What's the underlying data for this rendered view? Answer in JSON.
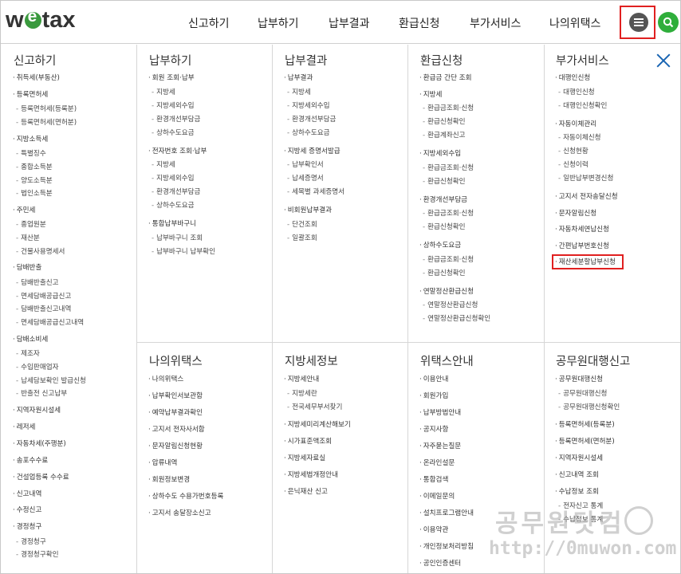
{
  "brand": {
    "logo_pre": "w",
    "logo_post": "tax"
  },
  "gnb": [
    "신고하기",
    "납부하기",
    "납부결과",
    "환급신청",
    "부가서비스",
    "나의위택스"
  ],
  "icons": {
    "menu": "hamburger-menu-icon",
    "search": "search-icon",
    "close": "close-icon"
  },
  "colors": {
    "highlight": "#e02020",
    "accent_green": "#2fae3b",
    "close_blue": "#1a66b3"
  },
  "sections": [
    {
      "title": "신고하기",
      "items": [
        {
          "t": "취득세(부동산)",
          "l": 1
        },
        {
          "t": "등록면허세",
          "l": 1
        },
        {
          "t": "등록면허세(등록분)",
          "l": 2
        },
        {
          "t": "등록면허세(면허분)",
          "l": 2
        },
        {
          "t": "지방소득세",
          "l": 1
        },
        {
          "t": "특별징수",
          "l": 2
        },
        {
          "t": "종합소득분",
          "l": 2
        },
        {
          "t": "양도소득분",
          "l": 2
        },
        {
          "t": "법인소득분",
          "l": 2
        },
        {
          "t": "주민세",
          "l": 1
        },
        {
          "t": "종업원분",
          "l": 2
        },
        {
          "t": "재산분",
          "l": 2
        },
        {
          "t": "건물사용명세서",
          "l": 2
        },
        {
          "t": "담배반출",
          "l": 1
        },
        {
          "t": "담배반출신고",
          "l": 2
        },
        {
          "t": "면세담배공급신고",
          "l": 2
        },
        {
          "t": "담배반출신고내역",
          "l": 2
        },
        {
          "t": "면세담배공급신고내역",
          "l": 2
        },
        {
          "t": "담배소비세",
          "l": 1
        },
        {
          "t": "제조자",
          "l": 2
        },
        {
          "t": "수입판매업자",
          "l": 2
        },
        {
          "t": "납세담보확인 발급신청",
          "l": 2
        },
        {
          "t": "반출전 신고납부",
          "l": 2
        },
        {
          "t": "지역자원시설세",
          "l": 1
        },
        {
          "t": "레저세",
          "l": 1
        },
        {
          "t": "자동차세(주행분)",
          "l": 1
        },
        {
          "t": "송포수수료",
          "l": 1
        },
        {
          "t": "건설업등록 수수료",
          "l": 1
        },
        {
          "t": "신고내역",
          "l": 1
        },
        {
          "t": "수정신고",
          "l": 1
        },
        {
          "t": "경정청구",
          "l": 1
        },
        {
          "t": "경정청구",
          "l": 2
        },
        {
          "t": "경정청구확인",
          "l": 2
        }
      ]
    },
    {
      "title": "납부하기",
      "items": [
        {
          "t": "회원 조회·납부",
          "l": 1
        },
        {
          "t": "지방세",
          "l": 2
        },
        {
          "t": "지방세외수입",
          "l": 2
        },
        {
          "t": "환경개선부담금",
          "l": 2
        },
        {
          "t": "상하수도요금",
          "l": 2
        },
        {
          "t": "전자번호 조회·납부",
          "l": 1
        },
        {
          "t": "지방세",
          "l": 2
        },
        {
          "t": "지방세외수입",
          "l": 2
        },
        {
          "t": "환경개선부담금",
          "l": 2
        },
        {
          "t": "상하수도요금",
          "l": 2
        },
        {
          "t": "통합납부바구니",
          "l": 1
        },
        {
          "t": "납부바구니 조회",
          "l": 2
        },
        {
          "t": "납부바구니 납부확인",
          "l": 2
        }
      ]
    },
    {
      "title": "납부결과",
      "items": [
        {
          "t": "납부결과",
          "l": 1
        },
        {
          "t": "지방세",
          "l": 2
        },
        {
          "t": "지방세외수입",
          "l": 2
        },
        {
          "t": "환경개선부담금",
          "l": 2
        },
        {
          "t": "상하수도요금",
          "l": 2
        },
        {
          "t": "지방세 증명서발급",
          "l": 1
        },
        {
          "t": "납부확인서",
          "l": 2
        },
        {
          "t": "납세증명서",
          "l": 2
        },
        {
          "t": "세목별 과세증명서",
          "l": 2
        },
        {
          "t": "비회원납부결과",
          "l": 1
        },
        {
          "t": "단건조회",
          "l": 2
        },
        {
          "t": "일괄조회",
          "l": 2
        }
      ]
    },
    {
      "title": "환급신청",
      "items": [
        {
          "t": "환급금 간단 조회",
          "l": 1
        },
        {
          "t": "지방세",
          "l": 1
        },
        {
          "t": "환급금조회·신청",
          "l": 2
        },
        {
          "t": "환급신청확인",
          "l": 2
        },
        {
          "t": "환급계좌신고",
          "l": 2
        },
        {
          "t": "지방세외수입",
          "l": 1
        },
        {
          "t": "환급금조회·신청",
          "l": 2
        },
        {
          "t": "환급신청확인",
          "l": 2
        },
        {
          "t": "환경개선부담금",
          "l": 1
        },
        {
          "t": "환급금조회·신청",
          "l": 2
        },
        {
          "t": "환급신청확인",
          "l": 2
        },
        {
          "t": "상하수도요금",
          "l": 1
        },
        {
          "t": "환급금조회·신청",
          "l": 2
        },
        {
          "t": "환급신청확인",
          "l": 2
        },
        {
          "t": "연말정산환급신청",
          "l": 1
        },
        {
          "t": "연말정산환급신청",
          "l": 2
        },
        {
          "t": "연말정산환급신청확인",
          "l": 2
        }
      ]
    },
    {
      "title": "부가서비스",
      "items": [
        {
          "t": "대행인신청",
          "l": 1
        },
        {
          "t": "대행인신청",
          "l": 2
        },
        {
          "t": "대행인신청확인",
          "l": 2
        },
        {
          "t": "자동이체관리",
          "l": 1
        },
        {
          "t": "자동이체신청",
          "l": 2
        },
        {
          "t": "신청현황",
          "l": 2
        },
        {
          "t": "신청이력",
          "l": 2
        },
        {
          "t": "일반납부변경신청",
          "l": 2
        },
        {
          "t": "고지서 전자송달신청",
          "l": 1
        },
        {
          "t": "문자알림신청",
          "l": 1
        },
        {
          "t": "자동차세연납신청",
          "l": 1
        },
        {
          "t": "간편납부번호신청",
          "l": 1
        },
        {
          "t": "재산세분할납부신청",
          "l": 1
        }
      ]
    },
    {
      "title": "나의위택스",
      "items": [
        {
          "t": "나의위택스",
          "l": 1
        },
        {
          "t": "납부확인서보관함",
          "l": 1
        },
        {
          "t": "예약납부결과확인",
          "l": 1
        },
        {
          "t": "고지서 전자사서함",
          "l": 1
        },
        {
          "t": "문자알림신청현황",
          "l": 1
        },
        {
          "t": "압류내역",
          "l": 1
        },
        {
          "t": "회원정보변경",
          "l": 1
        },
        {
          "t": "상하수도 수용가번호등록",
          "l": 1
        },
        {
          "t": "고지서 송달장소신고",
          "l": 1
        }
      ]
    },
    {
      "title": "지방세정보",
      "items": [
        {
          "t": "지방세안내",
          "l": 1
        },
        {
          "t": "지방세란",
          "l": 2
        },
        {
          "t": "전국세무부서찾기",
          "l": 2
        },
        {
          "t": "지방세미리계산해보기",
          "l": 1
        },
        {
          "t": "시가표준액조회",
          "l": 1
        },
        {
          "t": "지방세자료실",
          "l": 1
        },
        {
          "t": "지방세법개정안내",
          "l": 1
        },
        {
          "t": "은닉재산 신고",
          "l": 1
        }
      ]
    },
    {
      "title": "위택스안내",
      "items": [
        {
          "t": "이용안내",
          "l": 1
        },
        {
          "t": "회원가입",
          "l": 1
        },
        {
          "t": "납부방법안내",
          "l": 1
        },
        {
          "t": "공지사항",
          "l": 1
        },
        {
          "t": "자주묻는질문",
          "l": 1
        },
        {
          "t": "온라인설문",
          "l": 1
        },
        {
          "t": "통합검색",
          "l": 1
        },
        {
          "t": "이메일문의",
          "l": 1
        },
        {
          "t": "설치프로그램안내",
          "l": 1
        },
        {
          "t": "이용약관",
          "l": 1
        },
        {
          "t": "개인정보처리방침",
          "l": 1
        },
        {
          "t": "공인인증센터",
          "l": 1
        }
      ]
    },
    {
      "title": "공무원대행신고",
      "items": [
        {
          "t": "공무원대행신청",
          "l": 1
        },
        {
          "t": "공무원대행신청",
          "l": 2
        },
        {
          "t": "공무원대행신청확인",
          "l": 2
        },
        {
          "t": "등록면허세(등록분)",
          "l": 1
        },
        {
          "t": "등록면허세(면허분)",
          "l": 1
        },
        {
          "t": "지역자원시설세",
          "l": 1
        },
        {
          "t": "신고내역 조회",
          "l": 1
        },
        {
          "t": "수납정보 조회",
          "l": 1
        },
        {
          "t": "전자신고 통계",
          "l": 2
        },
        {
          "t": "수납정보 통계",
          "l": 2
        }
      ]
    }
  ],
  "watermark": {
    "line1": "공무원닷컴",
    "line2": "http://0muwon.com",
    "circle": "①"
  }
}
